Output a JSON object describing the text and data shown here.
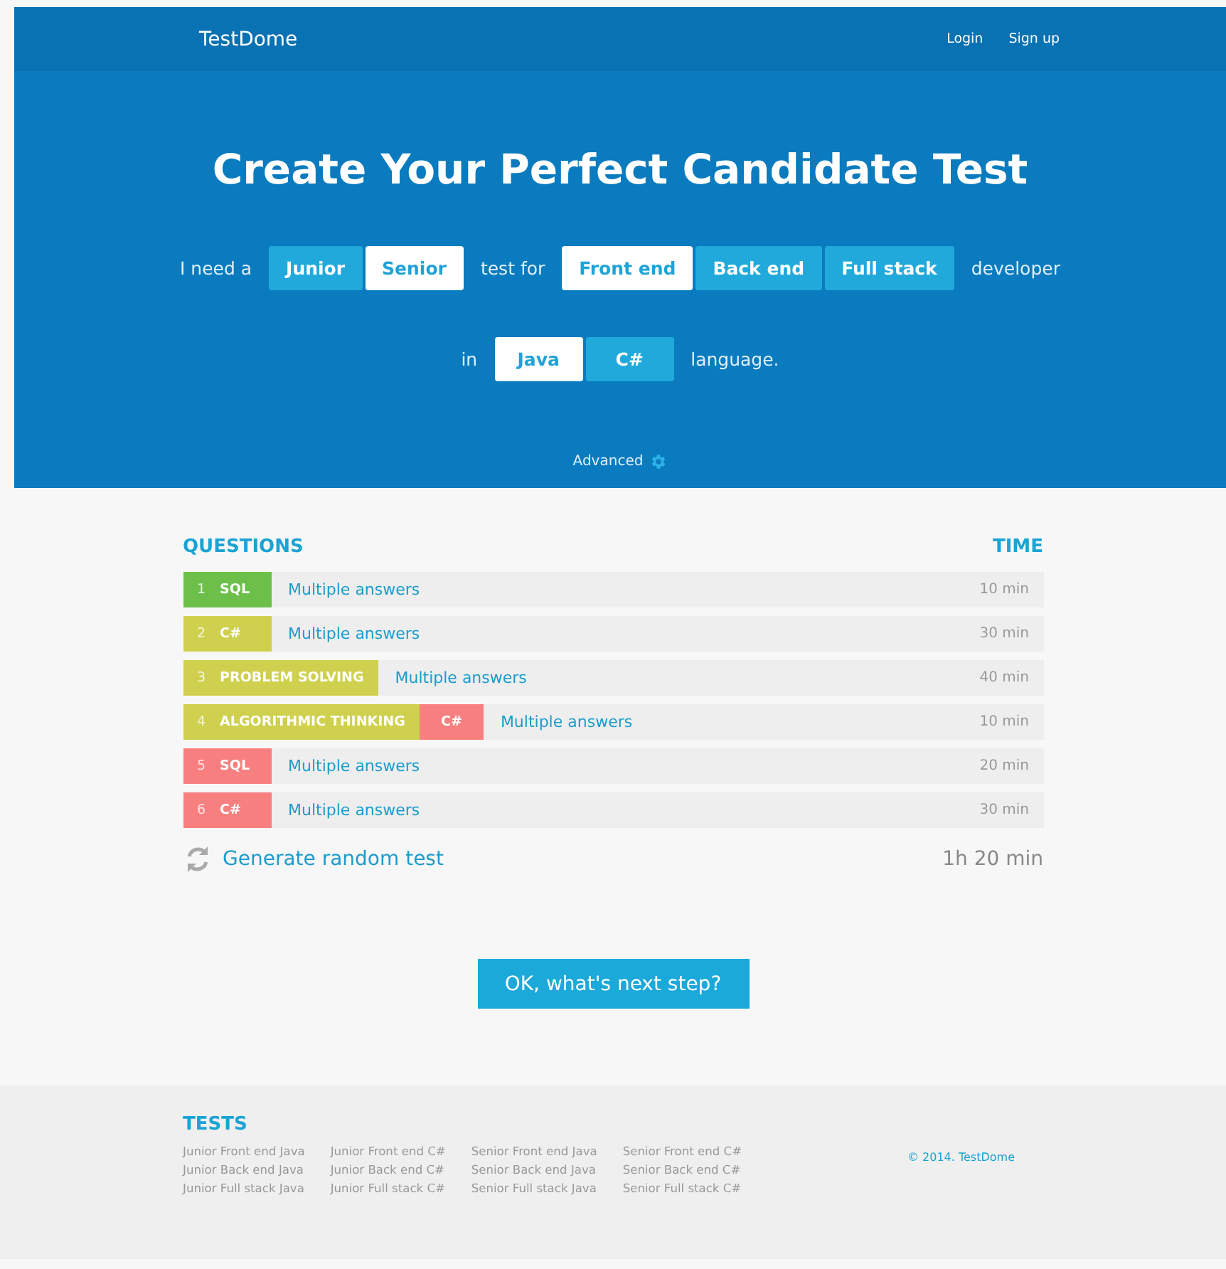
{
  "nav": {
    "brand": "TestDome",
    "links": [
      "Login",
      "Sign up"
    ]
  },
  "hero": {
    "title": "Create Your Perfect Candidate Test",
    "line1": {
      "prefix": "I need a",
      "levels": [
        {
          "label": "Junior",
          "selected": false
        },
        {
          "label": "Senior",
          "selected": true
        }
      ],
      "middle": "test for",
      "roles": [
        {
          "label": "Front end",
          "selected": true
        },
        {
          "label": "Back end",
          "selected": false
        },
        {
          "label": "Full stack",
          "selected": false
        }
      ],
      "suffix": "developer"
    },
    "line2": {
      "prefix": "in",
      "languages": [
        {
          "label": "Java",
          "selected": true
        },
        {
          "label": "C#",
          "selected": false
        }
      ],
      "suffix": "language."
    },
    "advanced": "Advanced"
  },
  "questions": {
    "heading": "QUESTIONS",
    "time_heading": "TIME",
    "rows": [
      {
        "number": "1",
        "tags": [
          {
            "label": "SQL",
            "color": "#6cc04a"
          }
        ],
        "type": "Multiple answers",
        "time": "10 min"
      },
      {
        "number": "2",
        "tags": [
          {
            "label": "C#",
            "color": "#cfd04e"
          }
        ],
        "type": "Multiple answers",
        "time": "30 min"
      },
      {
        "number": "3",
        "tags": [
          {
            "label": "PROBLEM SOLVING",
            "color": "#cfd04e"
          }
        ],
        "type": "Multiple answers",
        "time": "40 min"
      },
      {
        "number": "4",
        "tags": [
          {
            "label": "ALGORITHMIC THINKING",
            "color": "#cfd04e"
          },
          {
            "label": "C#",
            "color": "#f77f7f"
          }
        ],
        "type": "Multiple answers",
        "time": "10 min"
      },
      {
        "number": "5",
        "tags": [
          {
            "label": "SQL",
            "color": "#f77f7f"
          }
        ],
        "type": "Multiple answers",
        "time": "20 min"
      },
      {
        "number": "6",
        "tags": [
          {
            "label": "C#",
            "color": "#f77f7f"
          }
        ],
        "type": "Multiple answers",
        "time": "30 min"
      }
    ],
    "generate": "Generate random test",
    "total": "1h 20 min"
  },
  "next_button": "OK, what's next step?",
  "footer": {
    "heading": "TESTS",
    "columns": [
      [
        "Junior Front end Java",
        "Junior Back end Java",
        "Junior Full stack Java"
      ],
      [
        "Junior Front end C#",
        "Junior Back end C#",
        "Junior Full stack C#"
      ],
      [
        "Senior Front end Java",
        "Senior Back end Java",
        "Senior Full stack Java"
      ],
      [
        "Senior Front end C#",
        "Senior Back end C#",
        "Senior Full stack C#"
      ]
    ],
    "copyright": "© 2014. TestDome"
  }
}
